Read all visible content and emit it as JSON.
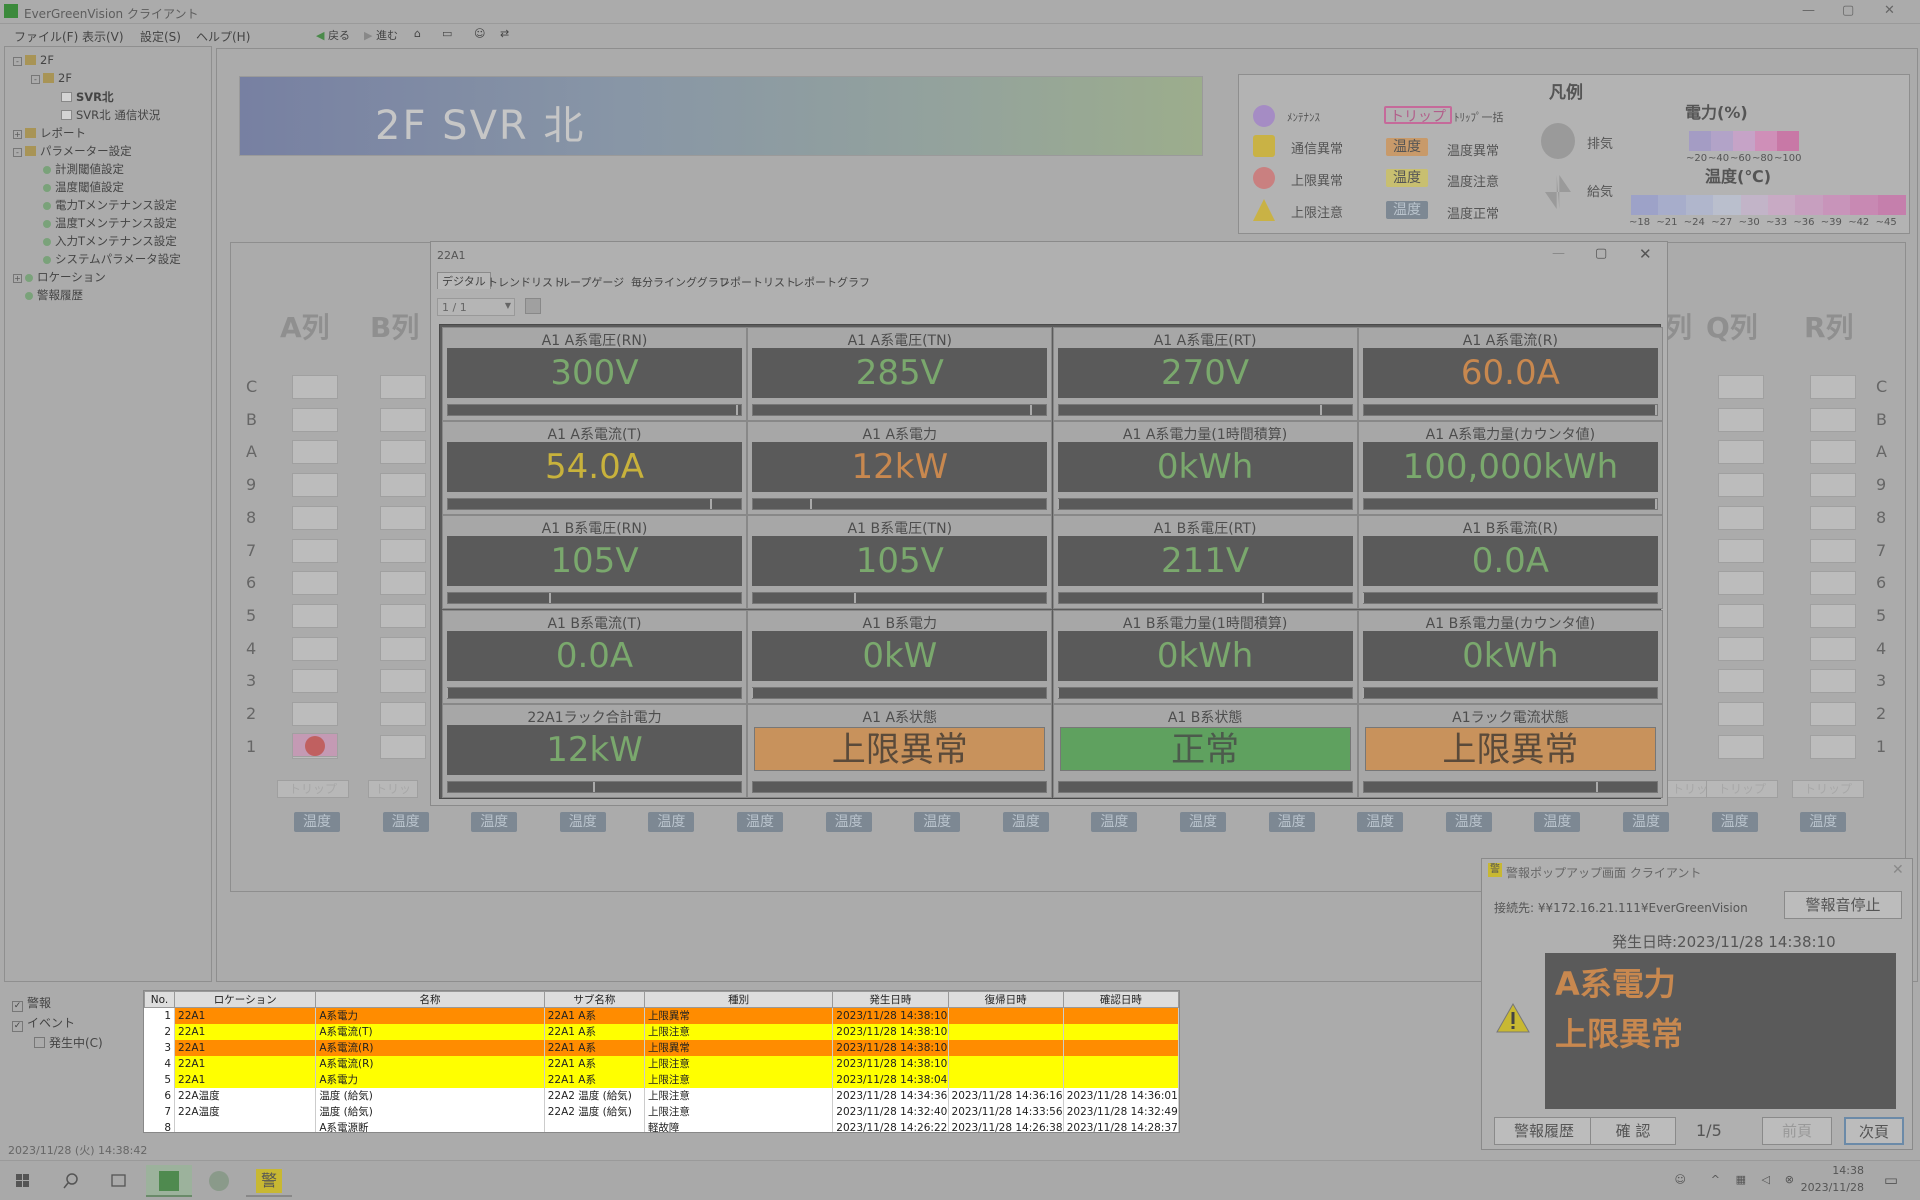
{
  "window": {
    "title": "EverGreenVision クライアント"
  },
  "menu": {
    "items": [
      "ファイル(F)",
      "表示(V)",
      "設定(S)",
      "ヘルプ(H)"
    ],
    "back": "戻る",
    "forward": "進む"
  },
  "tree": [
    {
      "label": "2F",
      "indent": 0,
      "icon": "folder",
      "exp": "-"
    },
    {
      "label": "2F",
      "indent": 1,
      "icon": "folder",
      "exp": "-"
    },
    {
      "label": "SVR北",
      "indent": 2,
      "icon": "page",
      "exp": ""
    },
    {
      "label": "SVR北 通信状況",
      "indent": 2,
      "icon": "page",
      "exp": ""
    },
    {
      "label": "レポート",
      "indent": 0,
      "icon": "folder",
      "exp": "+"
    },
    {
      "label": "パラメーター設定",
      "indent": 0,
      "icon": "folder",
      "exp": "-"
    },
    {
      "label": "計測閾値設定",
      "indent": 1,
      "icon": "dot",
      "exp": ""
    },
    {
      "label": "温度閾値設定",
      "indent": 1,
      "icon": "dot",
      "exp": ""
    },
    {
      "label": "電力Tメンテナンス設定",
      "indent": 1,
      "icon": "dot",
      "exp": ""
    },
    {
      "label": "温度Tメンテナンス設定",
      "indent": 1,
      "icon": "dot",
      "exp": ""
    },
    {
      "label": "入力Tメンテナンス設定",
      "indent": 1,
      "icon": "dot",
      "exp": ""
    },
    {
      "label": "システムパラメータ設定",
      "indent": 1,
      "icon": "dot",
      "exp": ""
    },
    {
      "label": "ロケーション",
      "indent": 0,
      "icon": "dot",
      "exp": "+"
    },
    {
      "label": "警報履歴",
      "indent": 0,
      "icon": "dot",
      "exp": ""
    }
  ],
  "banner": {
    "title": "2F SVR 北"
  },
  "legend": {
    "title": "凡例",
    "items": {
      "maintenance": "ﾒﾝﾃﾅﾝｽ",
      "trip_badge": "トリップ",
      "trip_all": "ﾄﾘｯﾌﾟ一括",
      "comm_error": "通信異常",
      "upper_error": "上限異常",
      "upper_warn": "上限注意",
      "temp_badge": "温度",
      "temp_error": "温度異常",
      "temp_warn": "温度注意",
      "temp_normal": "温度正常",
      "exhaust": "排気",
      "supply": "給気"
    },
    "power_title": "電力(%)",
    "power_scale": [
      "~20",
      "~40",
      "~60",
      "~80",
      "~100"
    ],
    "power_colors": [
      "#a49cc4",
      "#b2a3c8",
      "#c6a3c7",
      "#cf8fb8",
      "#c878a6"
    ],
    "temp_title": "温度(℃)",
    "temp_scale": [
      "~18",
      "~21",
      "~24",
      "~27",
      "~30",
      "~33",
      "~36",
      "~39",
      "~42",
      "~45"
    ],
    "temp_colors": [
      "#9da2c8",
      "#a7adcb",
      "#b0b6cc",
      "#babfcd",
      "#c2b4c8",
      "#c8aac4",
      "#c79fbf",
      "#c894ba",
      "#c889b3",
      "#c57fac"
    ]
  },
  "rack": {
    "left_cols": [
      "A列",
      "B列"
    ],
    "right_cols": [
      "Q列",
      "R列"
    ],
    "partial_right": "列",
    "rows": [
      "C",
      "B",
      "A",
      "9",
      "8",
      "7",
      "6",
      "5",
      "4",
      "3",
      "2",
      "1"
    ],
    "trip_label": "トリップ",
    "trip_partial": "トリッ",
    "temp_label": "温度"
  },
  "dialog": {
    "title": "22A1",
    "tabs": [
      "デジタル",
      "トレンドリスト",
      "ループゲージ",
      "毎分ラインググラフ",
      "レポートリスト",
      "レポートグラフ"
    ],
    "page": "1 / 1",
    "cells": [
      {
        "label": "A1 A系電圧(RN)",
        "value": "300V",
        "color": "green",
        "bar": 0.99
      },
      {
        "label": "A1 A系電圧(TN)",
        "value": "285V",
        "color": "green",
        "bar": 0.95
      },
      {
        "label": "A1 A系電圧(RT)",
        "value": "270V",
        "color": "green",
        "bar": 0.9
      },
      {
        "label": "A1 A系電流(R)",
        "value": "60.0A",
        "color": "orange",
        "bar": 1.0
      },
      {
        "label": "A1 A系電流(T)",
        "value": "54.0A",
        "color": "yellow",
        "bar": 0.9
      },
      {
        "label": "A1 A系電力",
        "value": "12kW",
        "color": "orange",
        "bar": 0.2
      },
      {
        "label": "A1 A系電力量(1時間積算)",
        "value": "0kWh",
        "color": "green",
        "bar": 0.0
      },
      {
        "label": "A1 A系電力量(カウンタ値)",
        "value": "100,000kWh",
        "color": "green",
        "bar": 1.0
      },
      {
        "label": "A1 B系電圧(RN)",
        "value": "105V",
        "color": "green",
        "bar": 0.35
      },
      {
        "label": "A1 B系電圧(TN)",
        "value": "105V",
        "color": "green",
        "bar": 0.35
      },
      {
        "label": "A1 B系電圧(RT)",
        "value": "211V",
        "color": "green",
        "bar": 0.7
      },
      {
        "label": "A1 B系電流(R)",
        "value": "0.0A",
        "color": "green",
        "bar": 0.0
      },
      {
        "label": "A1 B系電流(T)",
        "value": "0.0A",
        "color": "green",
        "bar": 0.0
      },
      {
        "label": "A1 B系電力",
        "value": "0kW",
        "color": "green",
        "bar": 0.0
      },
      {
        "label": "A1 B系電力量(1時間積算)",
        "value": "0kWh",
        "color": "green",
        "bar": 0.0
      },
      {
        "label": "A1 B系電力量(カウンタ値)",
        "value": "0kWh",
        "color": "green",
        "bar": 0.0
      },
      {
        "label": "22A1ラック合計電力",
        "value": "12kW",
        "color": "green",
        "bar": 0.5
      },
      {
        "label": "A1 A系状態",
        "value": "上限異常",
        "status": "ng"
      },
      {
        "label": "A1 B系状態",
        "value": "正常",
        "status": "ok"
      },
      {
        "label": "A1ラック電流状態",
        "value": "上限異常",
        "status": "ng",
        "bar": 0.8
      }
    ]
  },
  "bottom": {
    "checks": [
      {
        "label": "警報",
        "checked": true
      },
      {
        "label": "イベント",
        "checked": true
      },
      {
        "label": "発生中(C)",
        "checked": false
      }
    ],
    "columns": [
      "No.",
      "ロケーション",
      "名称",
      "サブ名称",
      "種別",
      "発生日時",
      "復帰日時",
      "確認日時"
    ],
    "rows": [
      {
        "no": "1",
        "loc": "22A1",
        "name": "A系電力",
        "sub": "22A1 A系",
        "kind": "上限異常",
        "occ": "2023/11/28 14:38:10",
        "ret": "",
        "conf": "",
        "style": "or"
      },
      {
        "no": "2",
        "loc": "22A1",
        "name": "A系電流(T)",
        "sub": "22A1 A系",
        "kind": "上限注意",
        "occ": "2023/11/28 14:38:10",
        "ret": "",
        "conf": "",
        "style": "ye"
      },
      {
        "no": "3",
        "loc": "22A1",
        "name": "A系電流(R)",
        "sub": "22A1 A系",
        "kind": "上限異常",
        "occ": "2023/11/28 14:38:10",
        "ret": "",
        "conf": "",
        "style": "or"
      },
      {
        "no": "4",
        "loc": "22A1",
        "name": "A系電流(R)",
        "sub": "22A1 A系",
        "kind": "上限注意",
        "occ": "2023/11/28 14:38:10",
        "ret": "",
        "conf": "",
        "style": "ye"
      },
      {
        "no": "5",
        "loc": "22A1",
        "name": "A系電力",
        "sub": "22A1 A系",
        "kind": "上限注意",
        "occ": "2023/11/28 14:38:04",
        "ret": "",
        "conf": "",
        "style": "ye"
      },
      {
        "no": "6",
        "loc": "22A温度",
        "name": "温度 (給気)",
        "sub": "22A2 温度 (給気)",
        "kind": "上限注意",
        "occ": "2023/11/28 14:34:36",
        "ret": "2023/11/28 14:36:16",
        "conf": "2023/11/28 14:36:01",
        "style": "wh"
      },
      {
        "no": "7",
        "loc": "22A温度",
        "name": "温度 (給気)",
        "sub": "22A2 温度 (給気)",
        "kind": "上限注意",
        "occ": "2023/11/28 14:32:40",
        "ret": "2023/11/28 14:33:56",
        "conf": "2023/11/28 14:32:49",
        "style": "wh"
      },
      {
        "no": "8",
        "loc": "",
        "name": "A系電源断",
        "sub": "",
        "kind": "軽故障",
        "occ": "2023/11/28 14:26:22",
        "ret": "2023/11/28 14:26:38",
        "conf": "2023/11/28 14:28:37",
        "style": "wh"
      }
    ],
    "status_time": "2023/11/28 (火) 14:38:42"
  },
  "popup": {
    "title": "警報ポップアップ画面 クライアント",
    "connection": "接続先: ¥¥172.16.21.111¥EverGreenVision",
    "stop_sound": "警報音停止",
    "occurred": "発生日時:2023/11/28 14:38:10",
    "msg_line1": "A系電力",
    "msg_line2": "上限異常",
    "history": "警報履歴",
    "confirm": "確 認",
    "page": "1/5",
    "prev": "前頁",
    "next": "次頁",
    "icon_char": "警"
  },
  "taskbar": {
    "time": "14:38",
    "date": "2023/11/28",
    "app_char": "警"
  }
}
